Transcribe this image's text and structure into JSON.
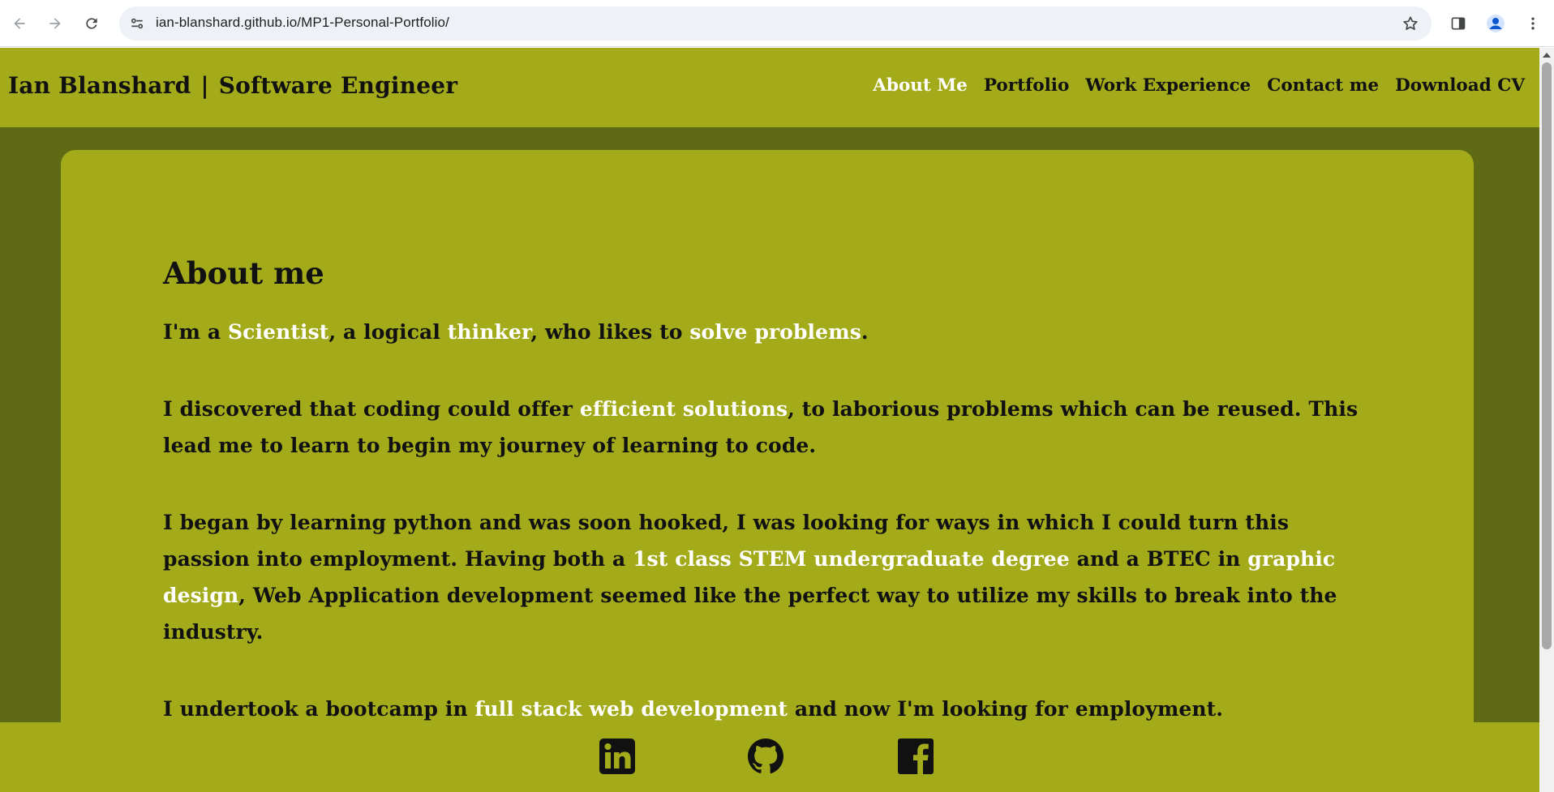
{
  "browser": {
    "url": "ian-blanshard.github.io/MP1-Personal-Portfolio/"
  },
  "header": {
    "name": "Ian Blanshard",
    "separator": "|",
    "role": "Software Engineer",
    "nav": [
      {
        "label": "About Me",
        "active": true
      },
      {
        "label": "Portfolio",
        "active": false
      },
      {
        "label": "Work Experience",
        "active": false
      },
      {
        "label": "Contact me",
        "active": false
      },
      {
        "label": "Download CV",
        "active": false
      }
    ]
  },
  "about": {
    "title": "About me",
    "p1": {
      "a": "I'm a ",
      "b": "Scientist",
      "c": ", a logical ",
      "d": "thinker",
      "e": ", who likes to ",
      "f": "solve problems",
      "g": "."
    },
    "p2": {
      "a": "I discovered that coding could offer ",
      "b": "efficient solutions",
      "c": ", to laborious problems which can be reused. This lead me to learn to begin my journey of learning to code."
    },
    "p3": {
      "a": "I began by learning python and was soon hooked, I was looking for ways in which I could turn this passion into employment. Having both a ",
      "b": "1st class STEM undergraduate degree",
      "c": " and a BTEC in ",
      "d": "graphic design",
      "e": ", Web Application development seemed like the perfect way to utilize my skills to break into the industry."
    },
    "p4": {
      "a": "I undertook a bootcamp in ",
      "b": "full stack web development",
      "c": " and now I'm looking for employment."
    }
  },
  "footer": {
    "icons": [
      "linkedin-icon",
      "github-icon",
      "facebook-icon"
    ]
  },
  "colors": {
    "header_bg": "#a3ab1a",
    "page_bg": "#5f6a14",
    "text": "#111111",
    "highlight": "#ffffff"
  }
}
